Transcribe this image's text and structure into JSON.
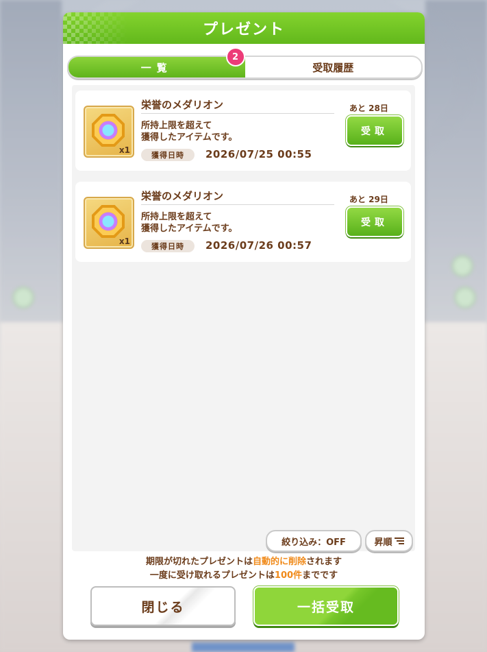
{
  "dialog": {
    "title": "プレゼント",
    "tabs": [
      {
        "label": "一覧",
        "badge": "2",
        "active": true
      },
      {
        "label": "受取履歴",
        "active": false
      }
    ]
  },
  "items": [
    {
      "name": "栄誉のメダリオン",
      "quantity": "x1",
      "description": "所持上限を超えて\n獲得したアイテムです。",
      "date_label": "獲得日時",
      "date": "2026/07/25 00:55",
      "remaining": "あと 28日",
      "receive_label": "受取"
    },
    {
      "name": "栄誉のメダリオン",
      "quantity": "x1",
      "description": "所持上限を超えて\n獲得したアイテムです。",
      "date_label": "獲得日時",
      "date": "2026/07/26 00:57",
      "remaining": "あと 29日",
      "receive_label": "受取"
    }
  ],
  "controls": {
    "filter_label": "絞り込み：OFF",
    "sort_label": "昇順"
  },
  "notes": {
    "line1_a": "期限が切れたプレゼントは",
    "line1_hl": "自動的に削除",
    "line1_b": "されます",
    "line2_a": "一度に受け取れるプレゼントは",
    "line2_hl": "100件",
    "line2_b": "までです"
  },
  "buttons": {
    "close_label": "閉じる",
    "bulk_label": "一括受取"
  },
  "colors": {
    "accent_green": "#62b81c",
    "text_brown": "#6b3c1b",
    "highlight_orange": "#f08a1a",
    "badge_pink": "#ec3c78"
  }
}
